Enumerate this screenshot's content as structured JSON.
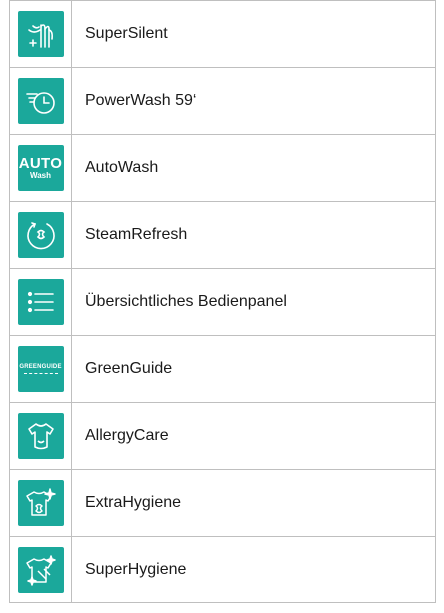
{
  "features": [
    {
      "label": "SuperSilent",
      "icon": "supersilent-icon"
    },
    {
      "label": "PowerWash 59‘",
      "icon": "powerwash-timer-icon"
    },
    {
      "label": "AutoWash",
      "icon": "autowash-icon",
      "icon_text": "AUTO",
      "icon_subtext": "Wash"
    },
    {
      "label": "SteamRefresh",
      "icon": "steam-refresh-icon"
    },
    {
      "label": "Übersichtliches Bedienpanel",
      "icon": "list-panel-icon"
    },
    {
      "label": "GreenGuide",
      "icon": "greenguide-icon",
      "icon_text": "GREENGUIDE"
    },
    {
      "label": "AllergyCare",
      "icon": "allergy-shirt-icon"
    },
    {
      "label": "ExtraHygiene",
      "icon": "extra-hygiene-icon"
    },
    {
      "label": "SuperHygiene",
      "icon": "super-hygiene-icon"
    }
  ],
  "colors": {
    "tile": "#1ba89b",
    "border": "#bfbfbf",
    "text": "#1a1a1a"
  }
}
